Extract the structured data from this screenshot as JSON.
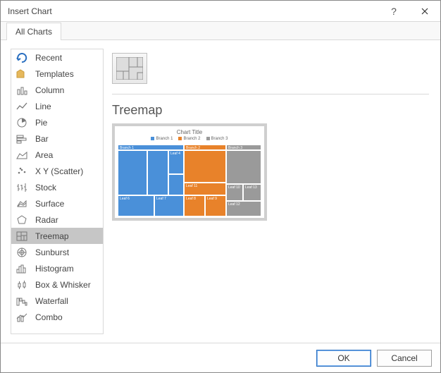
{
  "title": "Insert Chart",
  "tabs": {
    "all_charts": "All Charts"
  },
  "sidebar": {
    "items": [
      {
        "label": "Recent"
      },
      {
        "label": "Templates"
      },
      {
        "label": "Column"
      },
      {
        "label": "Line"
      },
      {
        "label": "Pie"
      },
      {
        "label": "Bar"
      },
      {
        "label": "Area"
      },
      {
        "label": "X Y (Scatter)"
      },
      {
        "label": "Stock"
      },
      {
        "label": "Surface"
      },
      {
        "label": "Radar"
      },
      {
        "label": "Treemap"
      },
      {
        "label": "Sunburst"
      },
      {
        "label": "Histogram"
      },
      {
        "label": "Box & Whisker"
      },
      {
        "label": "Waterfall"
      },
      {
        "label": "Combo"
      }
    ],
    "selected_index": 11
  },
  "content": {
    "type_label": "Treemap",
    "preview": {
      "chart_title": "Chart Title",
      "legend": {
        "b1": "Branch 1",
        "b2": "Branch 2",
        "b3": "Branch 3"
      },
      "labels": {
        "branch1": "Branch 1",
        "branch2": "Branch 2",
        "branch3": "Branch 3",
        "leaf4": "Leaf 4",
        "leaf6": "Leaf 6",
        "leaf7": "Leaf 7",
        "leaf8": "Leaf 8",
        "leaf9": "Leaf 9",
        "leaf10": "Leaf 10",
        "leaf11": "Leaf 11",
        "leaf12": "Leaf 12",
        "leaf13": "Leaf 13"
      }
    }
  },
  "footer": {
    "ok": "OK",
    "cancel": "Cancel"
  },
  "colors": {
    "blue": "#4a90d9",
    "orange": "#e8822a",
    "grey": "#9a9a9a"
  }
}
